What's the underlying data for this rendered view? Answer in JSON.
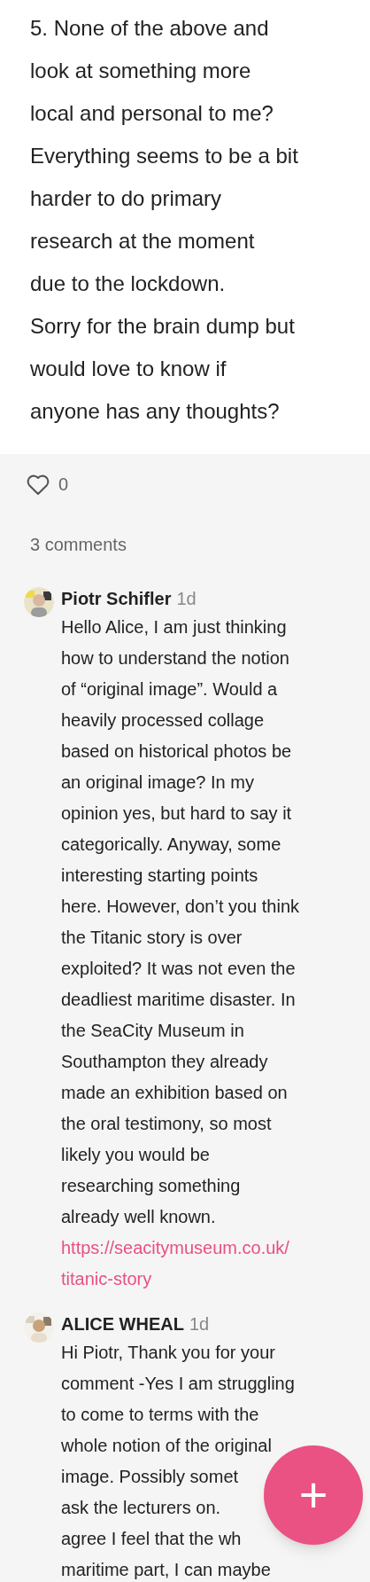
{
  "post": {
    "body_lines": [
      "5. None of the above and",
      "look at something more",
      "local and personal to me?",
      "Everything seems to be a bit",
      "harder to do primary",
      "research at the moment",
      "due to the lockdown.",
      "Sorry for the brain dump but",
      "would love to know if",
      "anyone has any thoughts?"
    ],
    "likes": "0",
    "liked": false
  },
  "comments_count": "3 comments",
  "comments": [
    {
      "author": "Piotr Schifler",
      "time": "1d",
      "body_lines": [
        "Hello Alice, I am just thinking",
        "how to understand the notion",
        "of “original image”. Would a",
        "heavily processed collage",
        "based on historical photos be",
        "an original image? In my",
        "opinion yes, but hard to say it",
        "categorically. Anyway, some",
        "interesting starting points",
        "here. However, don’t you think",
        "the Titanic story is over",
        "exploited? It was not even the",
        "deadliest maritime disaster. In",
        "the SeaCity Museum in",
        "Southampton they already",
        "made an exhibition based on",
        "the oral testimony, so most",
        "likely you would be",
        "researching something",
        "already well known."
      ],
      "link_lines": [
        "https://seacitymuseum.co.uk/",
        "titanic-story"
      ]
    },
    {
      "author": "ALICE WHEAL",
      "time": "1d",
      "body_lines": [
        "Hi Piotr, Thank you for your",
        "comment -Yes I am struggling",
        "to come to terms with the",
        "whole notion of the original",
        "image. Possibly somet",
        "ask the lecturers on.",
        "agree I feel that the wh",
        "maritime part, I can maybe"
      ]
    }
  ],
  "fab": {
    "label": "+"
  }
}
